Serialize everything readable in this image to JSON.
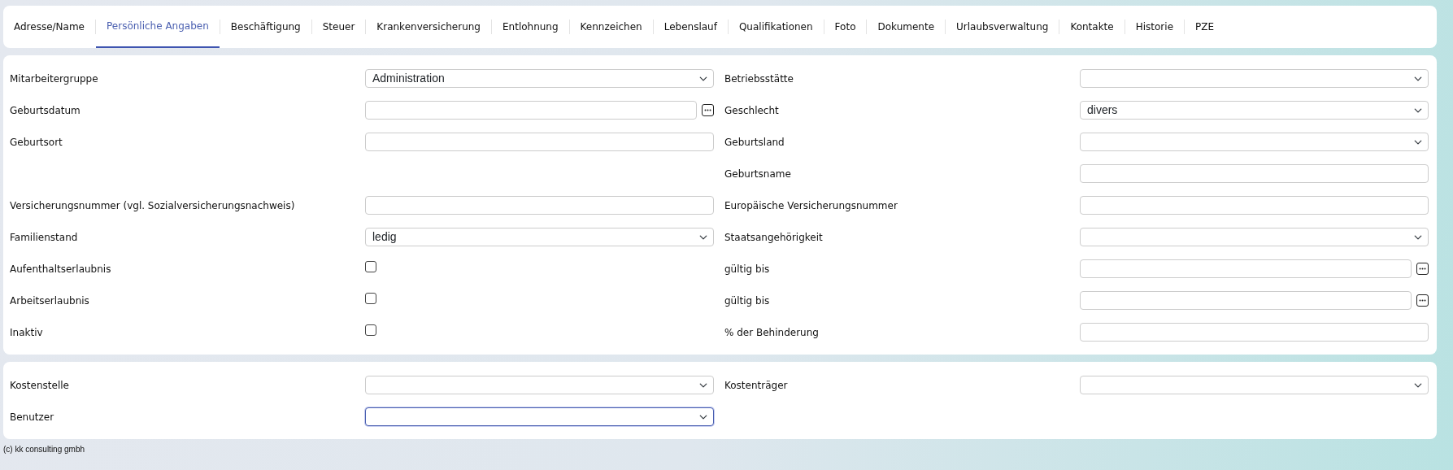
{
  "tabs": [
    {
      "label": "Adresse/Name",
      "selected": false
    },
    {
      "label": "Persönliche Angaben",
      "selected": true
    },
    {
      "label": "Beschäftigung",
      "selected": false
    },
    {
      "label": "Steuer",
      "selected": false
    },
    {
      "label": "Krankenversicherung",
      "selected": false
    },
    {
      "label": "Entlohnung",
      "selected": false
    },
    {
      "label": "Kennzeichen",
      "selected": false
    },
    {
      "label": "Lebenslauf",
      "selected": false
    },
    {
      "label": "Qualifikationen",
      "selected": false
    },
    {
      "label": "Foto",
      "selected": false
    },
    {
      "label": "Dokumente",
      "selected": false
    },
    {
      "label": "Urlaubsverwaltung",
      "selected": false
    },
    {
      "label": "Kontakte",
      "selected": false
    },
    {
      "label": "Historie",
      "selected": false
    },
    {
      "label": "PZE",
      "selected": false
    }
  ],
  "sections": [
    {
      "rows": [
        {
          "left": {
            "label": "Mitarbeitergruppe",
            "kind": "select",
            "value": "Administration",
            "focused": false
          },
          "right": {
            "label": "Betriebsstätte",
            "kind": "select",
            "focused": false
          }
        },
        {
          "left": {
            "label": "Geburtsdatum",
            "kind": "date",
            "focused": false
          },
          "right": {
            "label": "Geschlecht",
            "kind": "select",
            "value": "divers",
            "focused": false
          }
        },
        {
          "left": {
            "label": "Geburtsort",
            "kind": "text",
            "focused": false
          },
          "right": {
            "label": "Geburtsland",
            "kind": "select",
            "focused": false
          }
        },
        {
          "left": null,
          "right": {
            "label": "Geburtsname",
            "kind": "text",
            "focused": false
          }
        },
        {
          "left": {
            "label": "Versicherungsnummer (vgl. Sozialversicherungsnachweis)",
            "kind": "text",
            "focused": false
          },
          "right": {
            "label": "Europäische Versicherungsnummer",
            "kind": "text",
            "focused": false
          }
        },
        {
          "left": {
            "label": "Familienstand",
            "kind": "select",
            "value": "ledig",
            "focused": false
          },
          "right": {
            "label": "Staatsangehörigkeit",
            "kind": "select",
            "focused": false
          }
        },
        {
          "left": {
            "label": "Aufenthaltserlaubnis",
            "kind": "checkbox",
            "checked": false
          },
          "right": {
            "label": "gültig bis",
            "kind": "date",
            "focused": false
          }
        },
        {
          "left": {
            "label": "Arbeitserlaubnis",
            "kind": "checkbox",
            "checked": false
          },
          "right": {
            "label": "gültig bis",
            "kind": "date",
            "focused": false
          }
        },
        {
          "left": {
            "label": "Inaktiv",
            "kind": "checkbox",
            "checked": false
          },
          "right": {
            "label": "% der Behinderung",
            "kind": "text",
            "focused": false
          }
        }
      ]
    },
    {
      "rows": [
        {
          "left": {
            "label": "Kostenstelle",
            "kind": "select",
            "focused": false
          },
          "right": {
            "label": "Kostenträger",
            "kind": "select",
            "focused": false
          }
        },
        {
          "left": {
            "label": "Benutzer",
            "kind": "select",
            "focused": true
          },
          "right": null
        }
      ]
    }
  ],
  "footer": "(c) kk consulting gmbh"
}
